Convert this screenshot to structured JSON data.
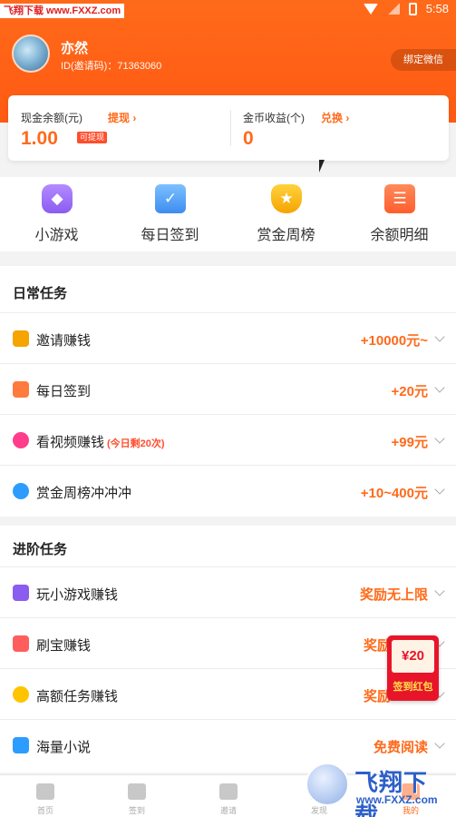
{
  "status_bar": {
    "watermark": "飞翔下载 www.FXXZ.com",
    "time": "5:58"
  },
  "profile": {
    "name": "亦然",
    "id_text": "ID(邀请码)：71363060",
    "bind_button": "绑定微信"
  },
  "balance": {
    "cash": {
      "label": "现金余额(元)",
      "link": "提现 ›",
      "value": "1.00",
      "tag": "可提现"
    },
    "coins": {
      "label": "金币收益(个)",
      "link": "兑换 ›",
      "value": "0"
    }
  },
  "quick_actions": [
    {
      "label": "小游戏",
      "icon": "gamepad-icon"
    },
    {
      "label": "每日签到",
      "icon": "calendar-check-icon"
    },
    {
      "label": "赏金周榜",
      "icon": "trophy-icon"
    },
    {
      "label": "余额明细",
      "icon": "ledger-icon"
    }
  ],
  "daily_tasks": {
    "title": "日常任务",
    "items": [
      {
        "label": "邀请赚钱",
        "note": "",
        "reward": "+10000元~",
        "icon": "users-icon",
        "color": "#f5a400"
      },
      {
        "label": "每日签到",
        "note": "",
        "reward": "+20元",
        "icon": "calendar-icon",
        "color": "#ff7a3d"
      },
      {
        "label": "看视频赚钱",
        "note": "(今日剩20次)",
        "reward": "+99元",
        "icon": "play-icon",
        "color": "#ff3d8a"
      },
      {
        "label": "赏金周榜冲冲冲",
        "note": "",
        "reward": "+10~400元",
        "icon": "medal-icon",
        "color": "#2d9cff"
      }
    ]
  },
  "advanced_tasks": {
    "title": "进阶任务",
    "items": [
      {
        "label": "玩小游戏赚钱",
        "reward": "奖励无上限",
        "icon": "gamepad-icon",
        "color": "#8a5cf0"
      },
      {
        "label": "刷宝赚钱",
        "reward": "奖励",
        "icon": "card-icon",
        "color": "#ff5e5e"
      },
      {
        "label": "高额任务赚钱",
        "reward": "奖励",
        "icon": "pacman-icon",
        "color": "#ffc400"
      },
      {
        "label": "海量小说",
        "reward": "免费阅读",
        "icon": "book-icon",
        "color": "#2d9cff"
      }
    ]
  },
  "red_packet": {
    "amount": "¥20",
    "label": "签到红包"
  },
  "tabbar": [
    {
      "label": "首页",
      "icon": "home-icon"
    },
    {
      "label": "签到",
      "icon": "sign-icon"
    },
    {
      "label": "邀请",
      "icon": "invite-icon"
    },
    {
      "label": "发现",
      "icon": "discover-icon"
    },
    {
      "label": "我的",
      "icon": "profile-icon"
    }
  ],
  "site_watermark": {
    "name": "飞翔下载",
    "url": "www.FXXZ.com"
  },
  "colors": {
    "brand": "#ff6a1a",
    "accent": "#ff4d2d"
  }
}
